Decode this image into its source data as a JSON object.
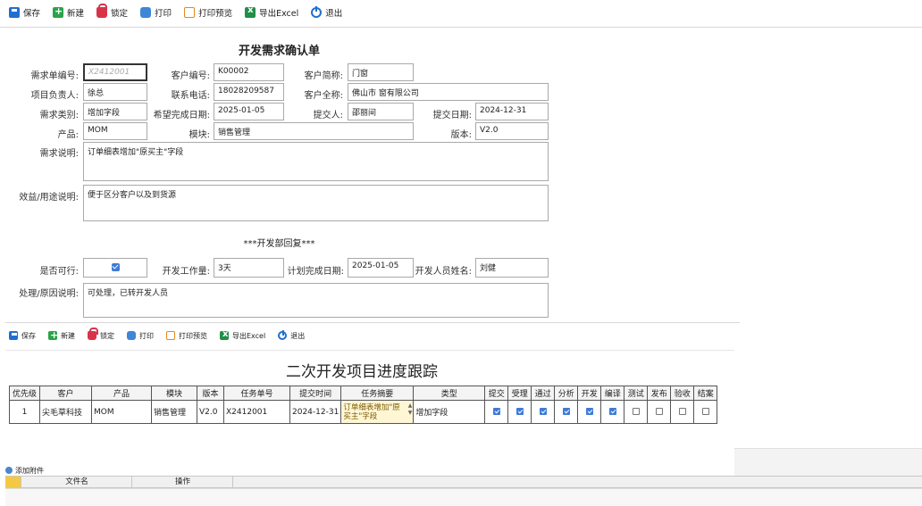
{
  "toolbar": {
    "save": "保存",
    "new": "新建",
    "lock": "锁定",
    "print": "打印",
    "print_preview": "打印预览",
    "export_excel": "导出Excel",
    "exit": "退出"
  },
  "form": {
    "title": "开发需求确认单",
    "req_no_label": "需求单编号:",
    "req_no_value": "X2412001",
    "cust_code_label": "客户编号:",
    "cust_code_value": "K00002",
    "cust_short_label": "客户简称:",
    "cust_short_value": "门窗",
    "proj_lead_label": "项目负责人:",
    "proj_lead_value": "徐总",
    "phone_label": "联系电话:",
    "phone_value": "18028209587",
    "cust_full_label": "客户全称:",
    "cust_full_value": "佛山市        窗有限公司",
    "req_type_label": "需求类别:",
    "req_type_value": "增加字段",
    "expect_date_label": "希望完成日期:",
    "expect_date_value": "2025-01-05",
    "submitter_label": "提交人:",
    "submitter_value": "邵丽间",
    "submit_date_label": "提交日期:",
    "submit_date_value": "2024-12-31",
    "product_label": "产品:",
    "product_value": "MOM",
    "module_label": "模块:",
    "module_value": "销售管理",
    "version_label": "版本:",
    "version_value": "V2.0",
    "req_desc_label": "需求说明:",
    "req_desc_value": "订单细表增加\"原买主\"字段",
    "benefit_label": "效益/用途说明:",
    "benefit_value": "便于区分客户以及到货源",
    "reply_heading": "***开发部回复***",
    "feasible_label": "是否可行:",
    "feasible_checked": true,
    "workload_label": "开发工作量:",
    "workload_value": "3天",
    "plan_date_label": "计划完成日期:",
    "plan_date_value": "2025-01-05",
    "developer_label": "开发人员姓名:",
    "developer_value": "刘健",
    "reason_label": "处理/原因说明:",
    "reason_value": "可处理，已转开发人员"
  },
  "tracking": {
    "title": "二次开发项目进度跟踪",
    "columns": [
      "优先级",
      "客户",
      "产品",
      "模块",
      "版本",
      "任务单号",
      "提交时间",
      "任务摘要",
      "类型",
      "提交",
      "受理",
      "通过",
      "分析",
      "开发",
      "编译",
      "测试",
      "发布",
      "验收",
      "结案"
    ],
    "row": {
      "priority": "1",
      "customer": "尖毛草科技",
      "product": "MOM",
      "module": "销售管理",
      "version": "V2.0",
      "task_no": "X2412001",
      "submit_time": "2024-12-31",
      "summary": "订单细表增加\"原买主\"字段",
      "type": "增加字段",
      "status": [
        true,
        true,
        true,
        true,
        true,
        true,
        false,
        false,
        false,
        false
      ]
    }
  },
  "attachments": {
    "add_label": "添加附件",
    "col_filename": "文件名",
    "col_action": "操作"
  }
}
